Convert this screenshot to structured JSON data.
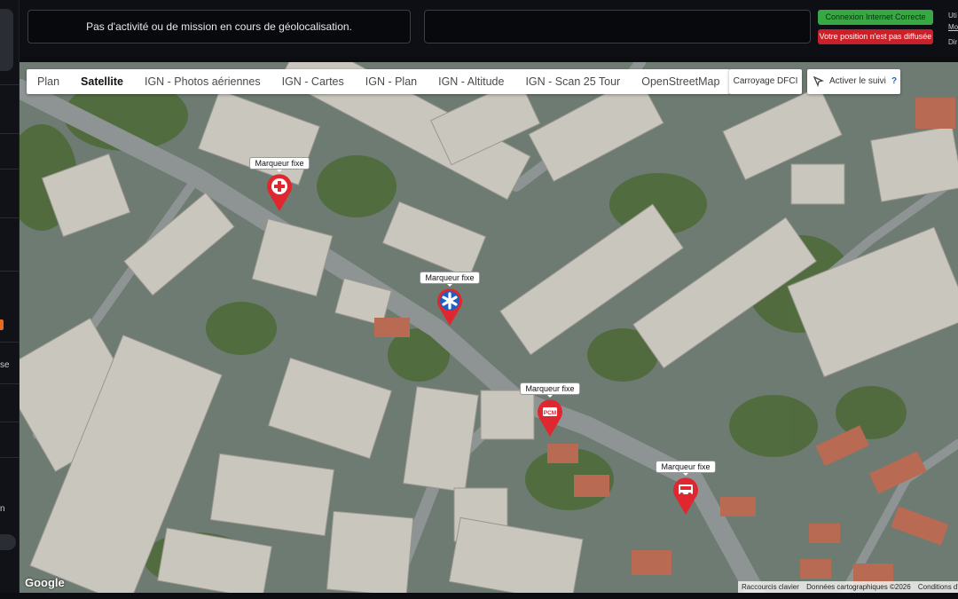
{
  "header": {
    "mission_status": "Pas d'activité ou de mission en cours de géolocalisation.",
    "connection_badge": "Connexion Internet Correcte",
    "position_badge": "Votre position n'est pas diffusée",
    "user_prefix": "Uti",
    "user_link": "Mo",
    "user_line3": "Dir"
  },
  "sidebar": {
    "item_text_1": "se",
    "item_text_2": "n"
  },
  "map": {
    "tabs": [
      "Plan",
      "Satellite",
      "IGN - Photos aériennes",
      "IGN - Cartes",
      "IGN - Plan",
      "IGN - Altitude",
      "IGN - Scan 25 Tour",
      "OpenStreetMap"
    ],
    "active_tab": "Satellite",
    "carroyage_button": "Carroyage DFCI",
    "follow_button": "Activer le suivi",
    "follow_help": "?",
    "markers": [
      {
        "label": "Marqueur fixe",
        "icon": "medical-cross-icon",
        "color": "#e0262e"
      },
      {
        "label": "Marqueur fixe",
        "icon": "star-of-life-icon",
        "color": "#1f5fbf"
      },
      {
        "label": "Marqueur fixe",
        "icon": "pcm-icon",
        "color": "#e0262e"
      },
      {
        "label": "Marqueur fixe",
        "icon": "fire-truck-icon",
        "color": "#e0262e"
      }
    ],
    "google_logo": "Google",
    "attribution": {
      "shortcuts": "Raccourcis clavier",
      "data": "Données cartographiques ©2026",
      "terms": "Conditions d'utilisation"
    }
  },
  "colors": {
    "connection_ok": "#38a845",
    "position_off": "#c9202a",
    "marker_red": "#e0262e",
    "marker_blue": "#1f5fbf"
  }
}
